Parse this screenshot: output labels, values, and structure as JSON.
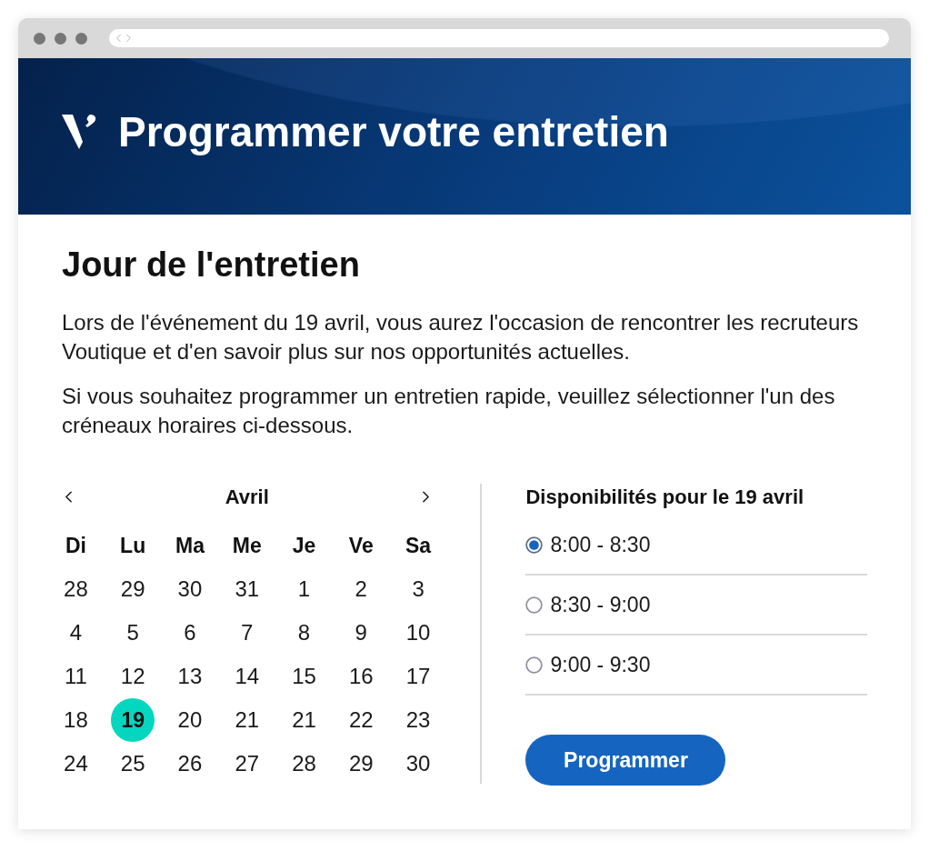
{
  "header": {
    "title": "Programmer votre entretien"
  },
  "intro": {
    "heading": "Jour de l'entretien",
    "paragraphs": [
      "Lors de l'événement du 19 avril, vous aurez l'occasion de rencontrer les recruteurs Voutique et d'en savoir plus sur nos opportunités actuelles.",
      "Si vous souhaitez programmer un entretien rapide, veuillez sélectionner l'un des créneaux horaires ci-dessous."
    ]
  },
  "calendar": {
    "month": "Avril",
    "weekdays": [
      "Di",
      "Lu",
      "Ma",
      "Me",
      "Je",
      "Ve",
      "Sa"
    ],
    "weeks": [
      [
        {
          "day": "28",
          "selected": false
        },
        {
          "day": "29",
          "selected": false
        },
        {
          "day": "30",
          "selected": false
        },
        {
          "day": "31",
          "selected": false
        },
        {
          "day": "1",
          "selected": false
        },
        {
          "day": "2",
          "selected": false
        },
        {
          "day": "3",
          "selected": false
        }
      ],
      [
        {
          "day": "4",
          "selected": false
        },
        {
          "day": "5",
          "selected": false
        },
        {
          "day": "6",
          "selected": false
        },
        {
          "day": "7",
          "selected": false
        },
        {
          "day": "8",
          "selected": false
        },
        {
          "day": "9",
          "selected": false
        },
        {
          "day": "10",
          "selected": false
        }
      ],
      [
        {
          "day": "11",
          "selected": false
        },
        {
          "day": "12",
          "selected": false
        },
        {
          "day": "13",
          "selected": false
        },
        {
          "day": "14",
          "selected": false
        },
        {
          "day": "15",
          "selected": false
        },
        {
          "day": "16",
          "selected": false
        },
        {
          "day": "17",
          "selected": false
        }
      ],
      [
        {
          "day": "18",
          "selected": false
        },
        {
          "day": "19",
          "selected": true
        },
        {
          "day": "20",
          "selected": false
        },
        {
          "day": "21",
          "selected": false
        },
        {
          "day": "21",
          "selected": false
        },
        {
          "day": "22",
          "selected": false
        },
        {
          "day": "23",
          "selected": false
        }
      ],
      [
        {
          "day": "24",
          "selected": false
        },
        {
          "day": "25",
          "selected": false
        },
        {
          "day": "26",
          "selected": false
        },
        {
          "day": "27",
          "selected": false
        },
        {
          "day": "28",
          "selected": false
        },
        {
          "day": "29",
          "selected": false
        },
        {
          "day": "30",
          "selected": false
        }
      ]
    ]
  },
  "availability": {
    "heading": "Disponibilités pour le 19 avril",
    "slots": [
      {
        "label": "8:00 - 8:30",
        "selected": true
      },
      {
        "label": "8:30 - 9:00",
        "selected": false
      },
      {
        "label": "9:00 - 9:30",
        "selected": false
      }
    ]
  },
  "submit_button": {
    "label": "Programmer"
  }
}
